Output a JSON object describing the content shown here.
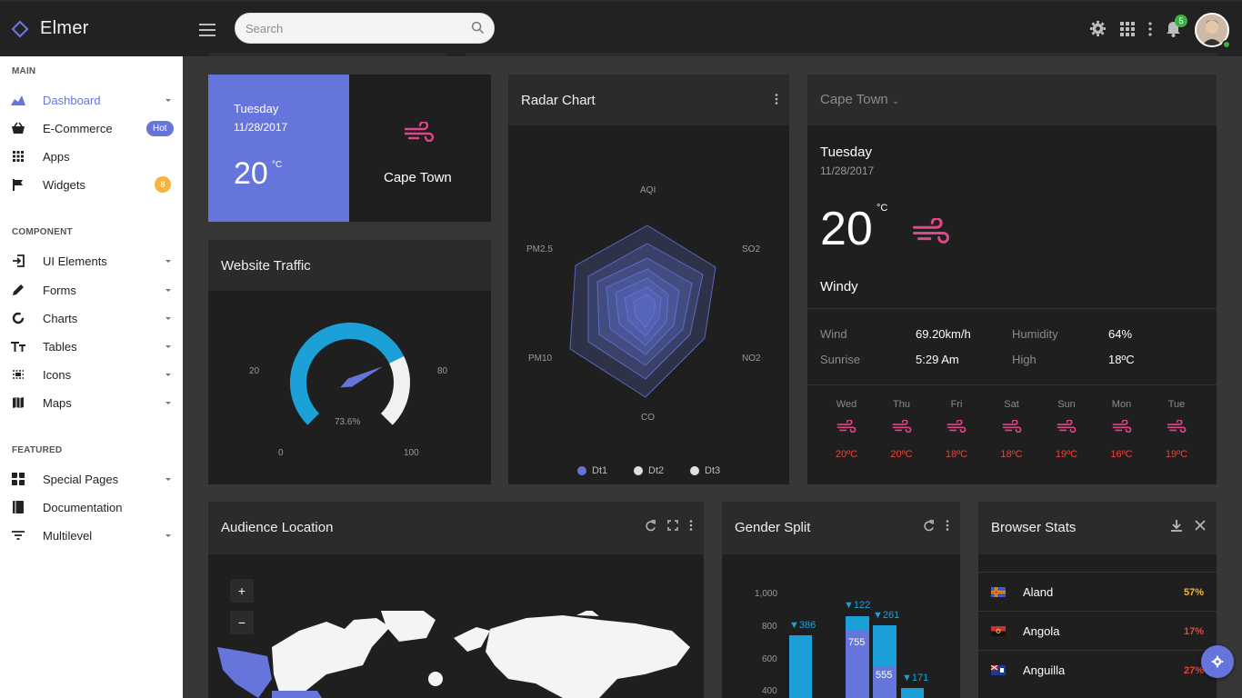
{
  "header": {
    "brand": "Elmer",
    "search_placeholder": "Search",
    "notification_count": "5"
  },
  "sidebar": {
    "sections": [
      {
        "title": "MAIN",
        "items": [
          {
            "label": "Dashboard",
            "icon": "chart-area-icon"
          },
          {
            "label": "E-Commerce",
            "badge": "Hot",
            "icon": "basket-icon"
          },
          {
            "label": "Apps",
            "icon": "grid-icon"
          },
          {
            "label": "Widgets",
            "badge": "8",
            "icon": "flag-icon"
          }
        ]
      },
      {
        "title": "COMPONENT",
        "items": [
          {
            "label": "UI Elements",
            "icon": "login-icon"
          },
          {
            "label": "Forms",
            "icon": "pencil-icon"
          },
          {
            "label": "Charts",
            "icon": "donut-icon"
          },
          {
            "label": "Tables",
            "icon": "text-height-icon"
          },
          {
            "label": "Icons",
            "icon": "select-icon"
          },
          {
            "label": "Maps",
            "icon": "map-icon"
          }
        ]
      },
      {
        "title": "FEATURED",
        "items": [
          {
            "label": "Special Pages",
            "icon": "pages-icon"
          },
          {
            "label": "Documentation",
            "icon": "book-icon"
          },
          {
            "label": "Multilevel",
            "icon": "filter-icon"
          }
        ]
      }
    ]
  },
  "weather_mini": {
    "day": "Tuesday",
    "date": "11/28/2017",
    "temp": "20",
    "unit": "°C",
    "city": "Cape Town"
  },
  "traffic": {
    "title": "Website Traffic",
    "value": 73.6,
    "value_label": "73.6%",
    "labels": {
      "min": "0",
      "l20": "20",
      "l80": "80",
      "max": "100"
    }
  },
  "radar": {
    "title": "Radar Chart",
    "axes": [
      "AQI",
      "SO2",
      "NO2",
      "CO",
      "PM10",
      "PM2.5"
    ],
    "legend": [
      "Dt1",
      "Dt2",
      "Dt3"
    ],
    "colors": [
      "#6675dc",
      "#e0e0e0",
      "#e0e0e0"
    ]
  },
  "weather": {
    "city": "Cape Town",
    "day": "Tuesday",
    "date": "11/28/2017",
    "temp": "20",
    "unit": "°C",
    "condition": "Windy",
    "wind_label": "Wind",
    "wind": "69.20km/h",
    "humidity_label": "Humidity",
    "humidity": "64%",
    "sunrise_label": "Sunrise",
    "sunrise": "5:29 Am",
    "high_label": "High",
    "high": "18ºC",
    "forecast": [
      {
        "day": "Wed",
        "temp": "20ºC"
      },
      {
        "day": "Thu",
        "temp": "20ºC"
      },
      {
        "day": "Fri",
        "temp": "18ºC"
      },
      {
        "day": "Sat",
        "temp": "18ºC"
      },
      {
        "day": "Sun",
        "temp": "19ºC"
      },
      {
        "day": "Mon",
        "temp": "16ºC"
      },
      {
        "day": "Tue",
        "temp": "19ºC"
      }
    ]
  },
  "audience": {
    "title": "Audience Location",
    "zoom_in": "+",
    "zoom_out": "−"
  },
  "gender": {
    "title": "Gender Split",
    "axis": [
      "1,000",
      "800",
      "600",
      "400"
    ],
    "labels": [
      "▼386",
      "▼122",
      "▼261",
      "▼171"
    ],
    "inner": [
      "755",
      "555"
    ]
  },
  "browser": {
    "title": "Browser Stats",
    "rows": [
      {
        "name": "Aland",
        "pct": "57%",
        "color": "#f6b53f"
      },
      {
        "name": "Angola",
        "pct": "17%",
        "color": "#e8453c"
      },
      {
        "name": "Anguilla",
        "pct": "27%",
        "color": "#e8453c"
      }
    ]
  }
}
